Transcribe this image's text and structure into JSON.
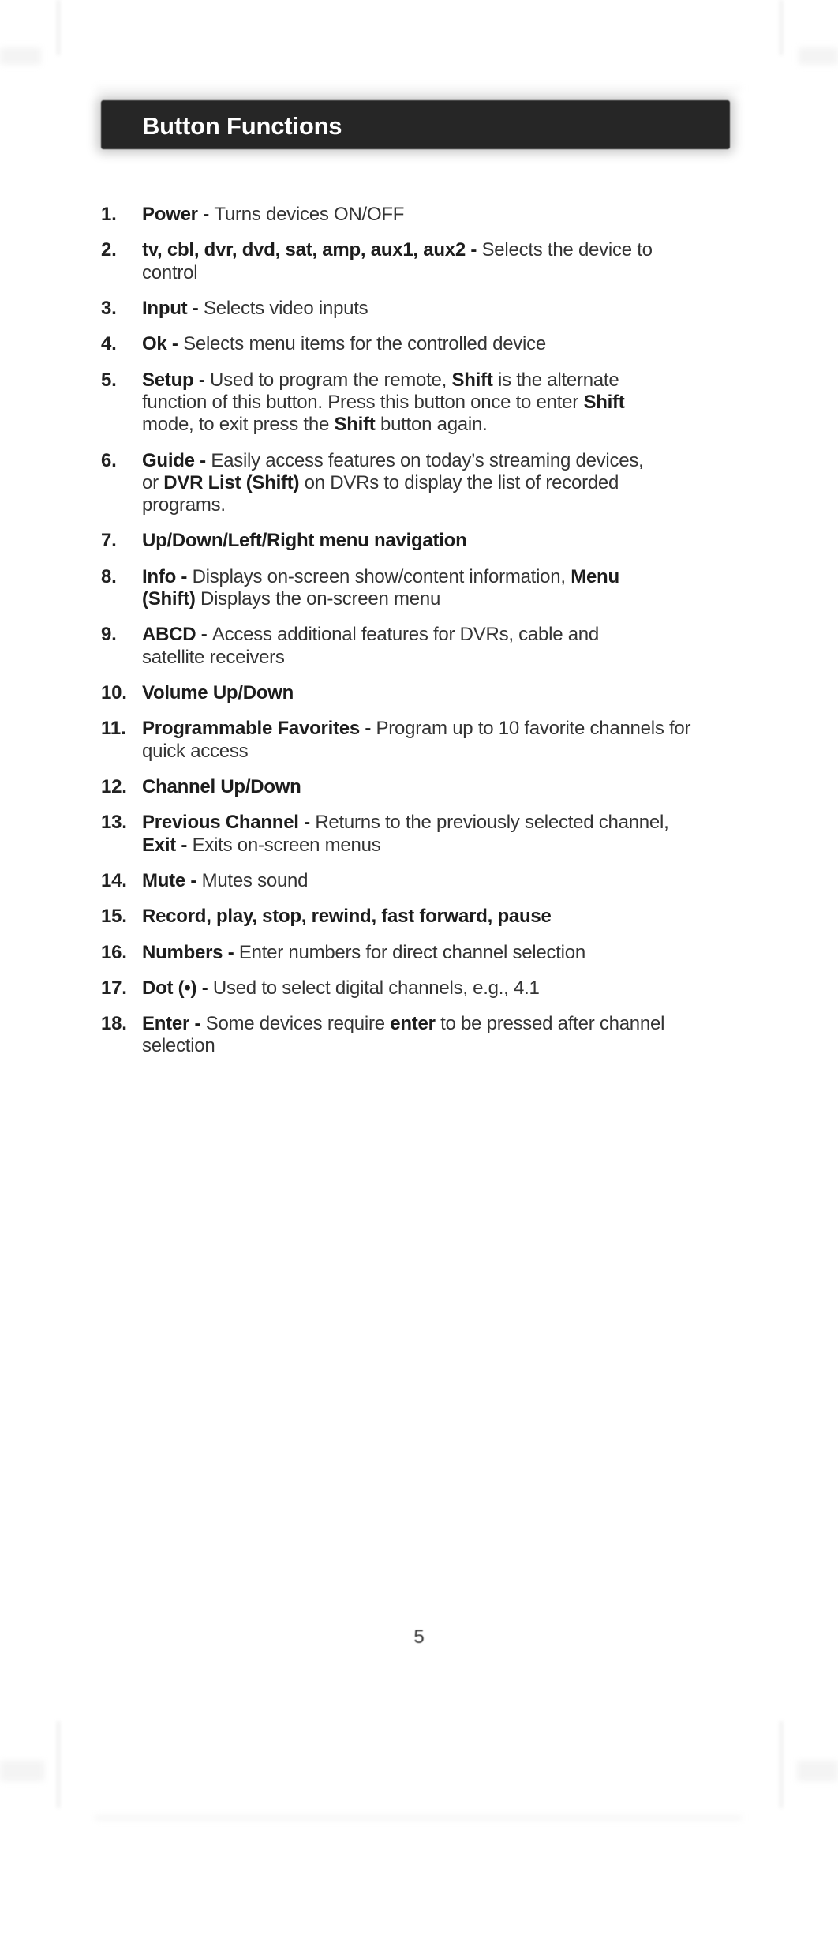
{
  "header": {
    "title": "Button Functions"
  },
  "page_number": "5",
  "colors": {
    "header_background": "#262626",
    "header_text": "#ffffff",
    "body_text": "#343434",
    "bold_text": "#1d1d1d",
    "page_background": "#ffffff"
  },
  "list": {
    "items": [
      {
        "number": "1.",
        "segments": [
          {
            "text": "Power - ",
            "bold": true
          },
          {
            "text": "Turns devices ON/OFF",
            "bold": false
          }
        ],
        "plain": "Power - Turns devices ON/OFF"
      },
      {
        "number": "2.",
        "segments": [
          {
            "text": "tv, cbl, dvr, dvd, sat, amp, aux1, aux2 - ",
            "bold": true
          },
          {
            "text": "Selects the device to control",
            "bold": false
          }
        ],
        "plain": "tv, cbl, dvr, dvd, sat, amp, aux1, aux2 - Selects the device to control"
      },
      {
        "number": "3.",
        "segments": [
          {
            "text": "Input - ",
            "bold": true
          },
          {
            "text": "Selects video inputs",
            "bold": false
          }
        ],
        "plain": "Input - Selects video inputs"
      },
      {
        "number": "4.",
        "segments": [
          {
            "text": "Ok - ",
            "bold": true
          },
          {
            "text": "Selects menu items for the controlled device",
            "bold": false
          }
        ],
        "plain": "Ok - Selects menu items for the controlled device"
      },
      {
        "number": "5.",
        "segments": [
          {
            "text": "Setup - ",
            "bold": true
          },
          {
            "text": "Used to program the remote, ",
            "bold": false
          },
          {
            "text": "Shift",
            "bold": true
          },
          {
            "text": " is the alternate function of this button. Press this button once to enter ",
            "bold": false
          },
          {
            "text": "Shift",
            "bold": true
          },
          {
            "text": " mode, to exit press the ",
            "bold": false
          },
          {
            "text": "Shift",
            "bold": true
          },
          {
            "text": " button again.",
            "bold": false
          }
        ],
        "plain": "Setup - Used to program the remote, Shift is the alternate function of this button. Press this button once to enter Shift mode, to exit press the Shift button again."
      },
      {
        "number": "6.",
        "segments": [
          {
            "text": "Guide - ",
            "bold": true
          },
          {
            "text": "Easily access features on today’s streaming devices, or ",
            "bold": false
          },
          {
            "text": "DVR List (Shift)",
            "bold": true
          },
          {
            "text": " on DVRs to display the list of recorded programs.",
            "bold": false
          }
        ],
        "plain": "Guide - Easily access features on today’s streaming devices, or DVR List (Shift) on DVRs to display the list of recorded programs."
      },
      {
        "number": "7.",
        "segments": [
          {
            "text": "Up/Down/Left/Right menu navigation",
            "bold": true
          }
        ],
        "plain": "Up/Down/Left/Right menu navigation"
      },
      {
        "number": "8.",
        "segments": [
          {
            "text": "Info - ",
            "bold": true
          },
          {
            "text": "Displays on-screen show/content information, ",
            "bold": false
          },
          {
            "text": "Menu (Shift)",
            "bold": true
          },
          {
            "text": " Displays the on-screen menu",
            "bold": false
          }
        ],
        "plain": "Info - Displays on-screen show/content information, Menu (Shift) Displays the on-screen menu"
      },
      {
        "number": "9.",
        "segments": [
          {
            "text": "ABCD - ",
            "bold": true
          },
          {
            "text": "Access additional features for DVRs, cable and satellite receivers",
            "bold": false
          }
        ],
        "plain": "ABCD - Access additional features for DVRs, cable and satellite receivers"
      },
      {
        "number": "10.",
        "segments": [
          {
            "text": "Volume Up/Down",
            "bold": true
          }
        ],
        "plain": "Volume Up/Down"
      },
      {
        "number": "11.",
        "segments": [
          {
            "text": "Programmable Favorites - ",
            "bold": true
          },
          {
            "text": "Program up to 10 favorite channels for quick access",
            "bold": false
          }
        ],
        "plain": "Programmable Favorites - Program up to 10 favorite channels for quick access"
      },
      {
        "number": "12.",
        "segments": [
          {
            "text": "Channel Up/Down",
            "bold": true
          }
        ],
        "plain": "Channel Up/Down"
      },
      {
        "number": "13.",
        "segments": [
          {
            "text": "Previous Channel - ",
            "bold": true
          },
          {
            "text": "Returns to the previously selected channel, ",
            "bold": false
          },
          {
            "text": "Exit - ",
            "bold": true
          },
          {
            "text": "Exits on-screen menus",
            "bold": false
          }
        ],
        "plain": "Previous Channel - Returns to the previously selected channel, Exit - Exits on-screen menus"
      },
      {
        "number": "14.",
        "segments": [
          {
            "text": "Mute - ",
            "bold": true
          },
          {
            "text": "Mutes sound",
            "bold": false
          }
        ],
        "plain": "Mute - Mutes sound"
      },
      {
        "number": "15.",
        "segments": [
          {
            "text": "Record, play, stop, rewind, fast forward, pause",
            "bold": true
          }
        ],
        "plain": "Record, play, stop, rewind, fast forward, pause"
      },
      {
        "number": "16.",
        "segments": [
          {
            "text": "Numbers - ",
            "bold": true
          },
          {
            "text": "Enter numbers for direct channel selection",
            "bold": false
          }
        ],
        "plain": "Numbers - Enter numbers for direct channel selection"
      },
      {
        "number": "17.",
        "segments": [
          {
            "text": "Dot (•) - ",
            "bold": true
          },
          {
            "text": "Used to select digital channels, e.g., 4.1",
            "bold": false
          }
        ],
        "plain": "Dot (•) - Used to select digital channels, e.g., 4.1"
      },
      {
        "number": "18.",
        "segments": [
          {
            "text": "Enter - ",
            "bold": true
          },
          {
            "text": " Some devices require ",
            "bold": false
          },
          {
            "text": "enter",
            "bold": true
          },
          {
            "text": " to be pressed after channel selection",
            "bold": false
          }
        ],
        "plain": "Enter -  Some devices require enter to be pressed after channel selection"
      }
    ]
  }
}
